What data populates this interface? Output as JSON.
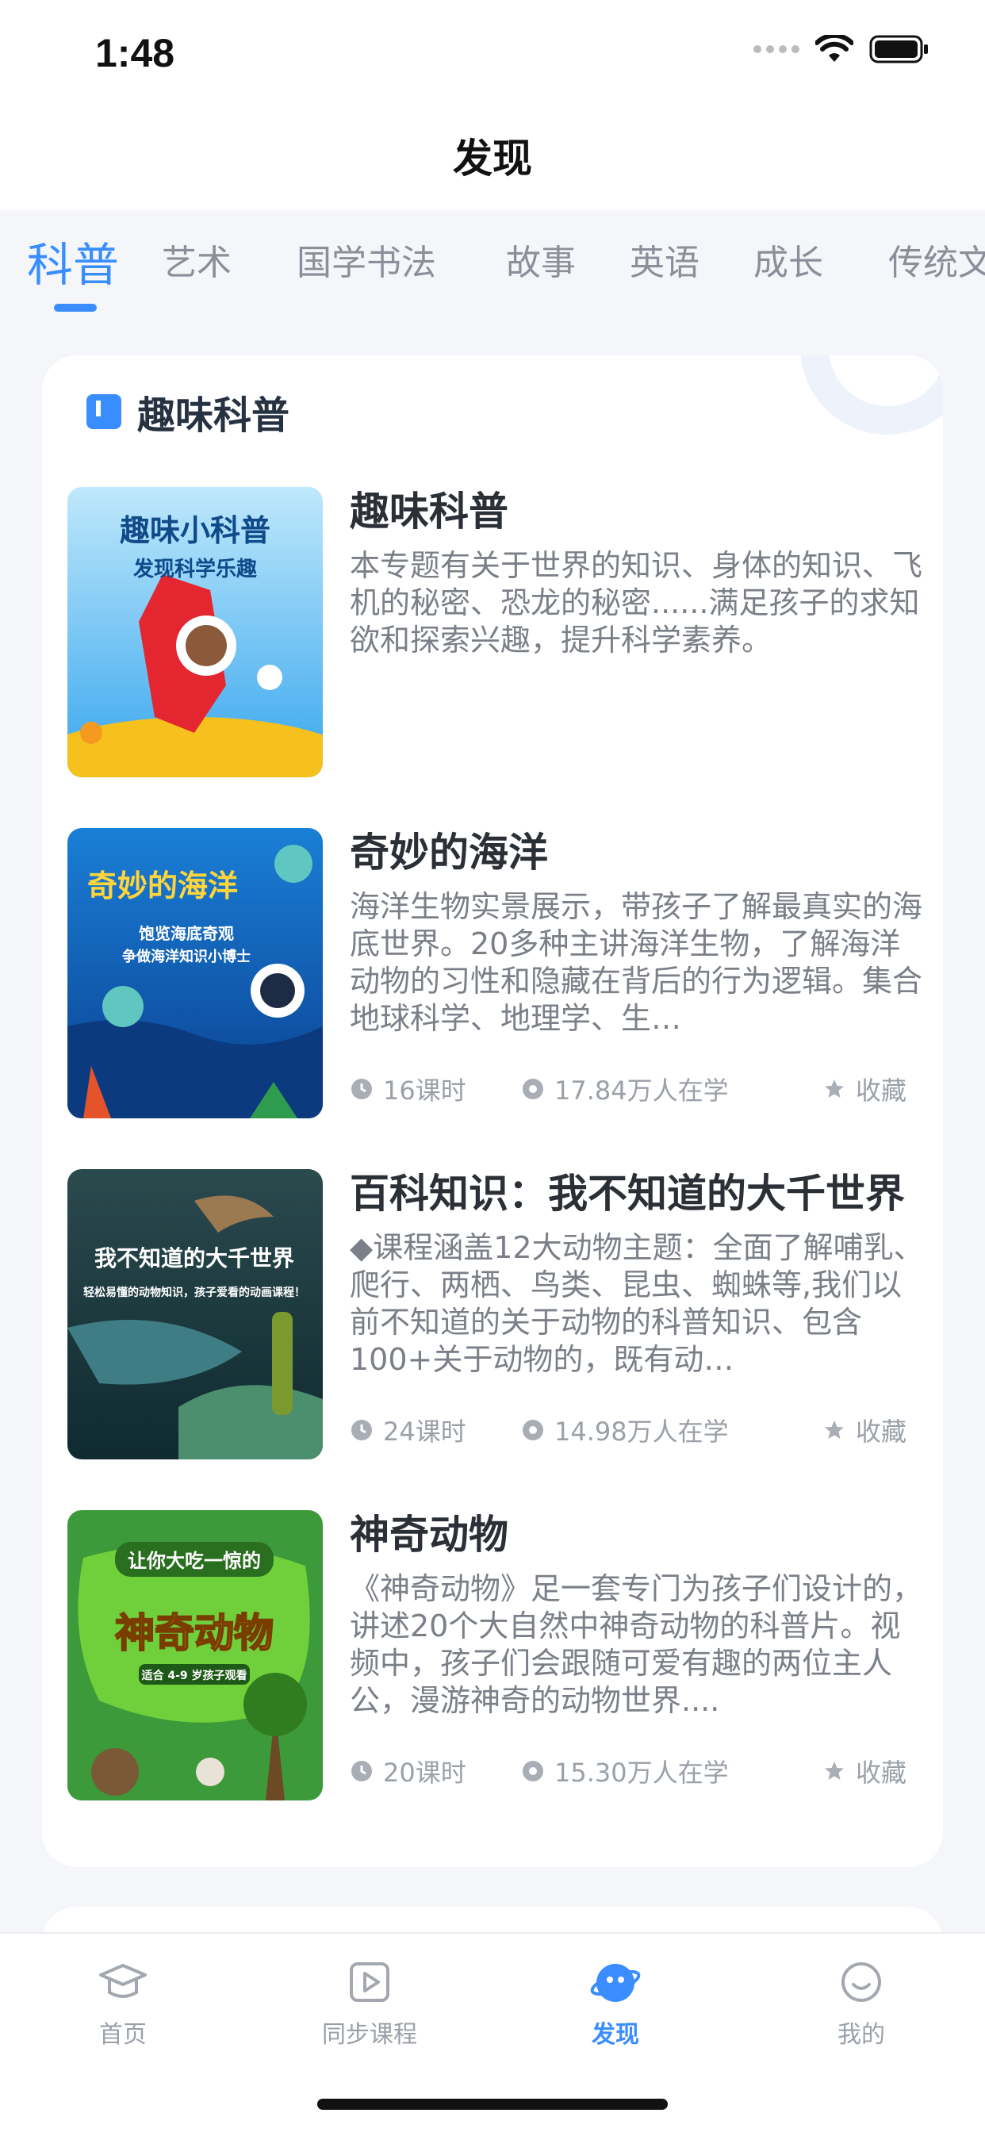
{
  "status_bar": {
    "time": "1:48"
  },
  "header": {
    "title": "发现"
  },
  "tabs": [
    {
      "label": "科普",
      "active": true
    },
    {
      "label": "艺术"
    },
    {
      "label": "国学书法"
    },
    {
      "label": "故事"
    },
    {
      "label": "英语"
    },
    {
      "label": "成长"
    },
    {
      "label": "传统文"
    }
  ],
  "section": {
    "title": "趣味科普",
    "courses": [
      {
        "title": "趣味科普",
        "cover_text": [
          "趣味小科普",
          "发现科学乐趣"
        ],
        "description": "本专题有关于世界的知识、身体的知识、飞机的秘密、恐龙的秘密......满足孩子的求知欲和探索兴趣，提升科学素养。"
      },
      {
        "title": "奇妙的海洋",
        "cover_text": [
          "奇妙的海洋",
          "饱览海底奇观",
          "争做海洋知识小博士"
        ],
        "description": "海洋生物实景展示，带孩子了解最真实的海底世界。20多种主讲海洋生物，了解海洋动物的习性和隐藏在背后的行为逻辑。集合地球科学、地理学、生…",
        "lessons": "16课时",
        "learners": "17.84万人在学",
        "favorite": "收藏"
      },
      {
        "title": "百科知识：我不知道的大千世界",
        "cover_text": [
          "我不知道的大千世界",
          "轻松易懂的动物知识，孩子爱看的动画课程！"
        ],
        "description": "◆课程涵盖12大动物主题：全面了解哺乳、爬行、两栖、鸟类、昆虫、蜘蛛等,我们以前不知道的关于动物的科普知识、包含100+关于动物的，既有动…",
        "lessons": "24课时",
        "learners": "14.98万人在学",
        "favorite": "收藏"
      },
      {
        "title": "神奇动物",
        "cover_text": [
          "让你大吃一惊的",
          "神奇动物",
          "适合 4-9 岁孩子观看"
        ],
        "description": "《神奇动物》足一套专门为孩子们设计的，讲述20个大自然中神奇动物的科普片。视频中，孩子们会跟随可爱有趣的两位主人公，漫游神奇的动物世界....",
        "lessons": "20课时",
        "learners": "15.30万人在学",
        "favorite": "收藏"
      }
    ]
  },
  "tabbar": [
    {
      "label": "首页",
      "icon": "graduation-cap-icon"
    },
    {
      "label": "同步课程",
      "icon": "play-icon"
    },
    {
      "label": "发现",
      "icon": "planet-icon",
      "active": true
    },
    {
      "label": "我的",
      "icon": "smile-icon"
    }
  ],
  "colors": {
    "accent": "#3a8dff",
    "background": "#f4f6fa",
    "text_muted": "#9aa0a8"
  }
}
